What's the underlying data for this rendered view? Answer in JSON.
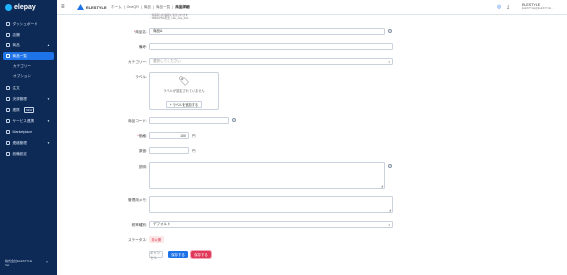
{
  "brand": {
    "name": "elepay"
  },
  "sidebar": {
    "items": [
      {
        "label": "ダッシュボード",
        "icon": "dashboard-icon"
      },
      {
        "label": "店舗",
        "icon": "store-icon"
      },
      {
        "label": "商品",
        "icon": "box-icon"
      },
      {
        "label": "商品一覧",
        "icon": "list-icon"
      },
      {
        "label": "カテゴリー",
        "icon": ""
      },
      {
        "label": "オプション",
        "icon": ""
      },
      {
        "label": "注文",
        "icon": "receipt-icon"
      },
      {
        "label": "決済管理",
        "icon": "wallet-icon"
      },
      {
        "label": "連携",
        "icon": "link-icon",
        "badge": "NEW"
      },
      {
        "label": "サービス連携",
        "icon": "puzzle-icon"
      },
      {
        "label": "Marketplace",
        "icon": "cart-icon"
      },
      {
        "label": "連絡管理",
        "icon": "mail-icon"
      },
      {
        "label": "設備設定",
        "icon": "gear-icon"
      }
    ],
    "footer": {
      "line1": "株式会社ELESTYLE",
      "line2": "Ver"
    }
  },
  "topbar": {
    "store_name": "ELESTYLE",
    "breadcrumbs": [
      "ホーム",
      "OneQR",
      "商品",
      "商品一覧",
      "商品詳細"
    ],
    "user_name": "ELESTYLE",
    "user_sub": "ELESTYLE@ELESTYLE..."
  },
  "form": {
    "note_line1": "・商品名はお客様に表示されます",
    "note_line2": "・JPEG/PNG形式, max_size_limit",
    "product_name": {
      "label": "商品名",
      "value": "商品A"
    },
    "subtitle": {
      "label": "備考",
      "value": ""
    },
    "category": {
      "label": "カテゴリー",
      "placeholder": "選択してください"
    },
    "label_field": {
      "label": "ラベル",
      "empty_text": "ラベルが設定されていません",
      "button": "ラベルを追加する"
    },
    "product_code": {
      "label": "商品コード",
      "value": ""
    },
    "price": {
      "label": "価格",
      "value": "100",
      "unit": "円"
    },
    "cost": {
      "label": "原価",
      "value": "",
      "unit": "円"
    },
    "description": {
      "label": "説明"
    },
    "memo": {
      "label": "管理用メモ"
    },
    "tax": {
      "label": "税率種別",
      "value": "デフォルト"
    },
    "status": {
      "label": "ステータス",
      "value": "非公開"
    }
  },
  "actions": {
    "cancel": "キャンセル",
    "save": "保存する",
    "apply": "保存する"
  },
  "colors": {
    "sidebar": "#0d2a57",
    "accent": "#1f73e8",
    "danger": "#e0395a"
  }
}
